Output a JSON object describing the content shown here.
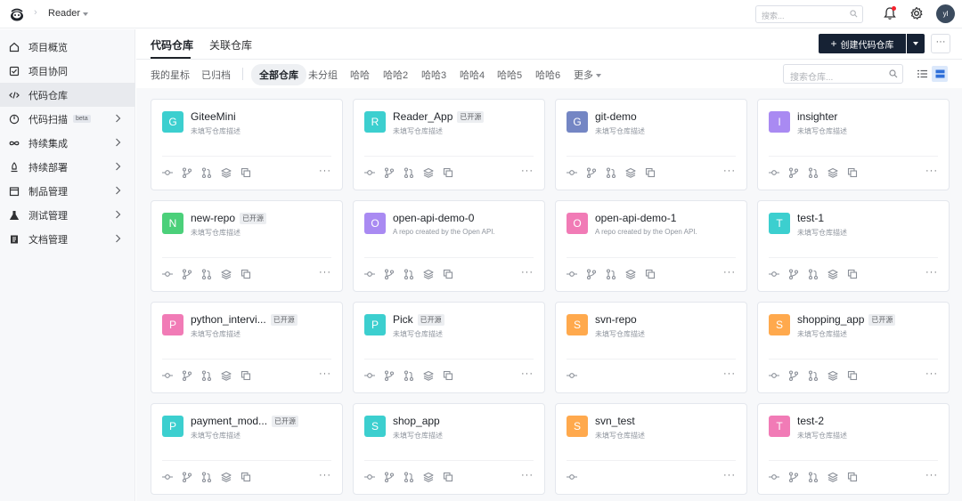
{
  "header": {
    "project_name": "Reader",
    "search_placeholder": "搜索...",
    "avatar_text": "yl"
  },
  "sidebar": {
    "items": [
      {
        "label": "项目概览",
        "icon": "home-icon",
        "chevron": false,
        "active": false
      },
      {
        "label": "项目协同",
        "icon": "checkbox-icon",
        "chevron": false,
        "active": false
      },
      {
        "label": "代码仓库",
        "icon": "code-icon",
        "chevron": false,
        "active": true
      },
      {
        "label": "代码扫描",
        "icon": "scan-icon",
        "chevron": true,
        "active": false,
        "beta": "beta"
      },
      {
        "label": "持续集成",
        "icon": "infinity-icon",
        "chevron": true,
        "active": false
      },
      {
        "label": "持续部署",
        "icon": "rocket-icon",
        "chevron": true,
        "active": false
      },
      {
        "label": "制品管理",
        "icon": "package-icon",
        "chevron": true,
        "active": false
      },
      {
        "label": "测试管理",
        "icon": "flask-icon",
        "chevron": true,
        "active": false
      },
      {
        "label": "文档管理",
        "icon": "document-icon",
        "chevron": true,
        "active": false
      }
    ]
  },
  "main": {
    "tabs": [
      {
        "label": "代码仓库",
        "active": true
      },
      {
        "label": "关联仓库",
        "active": false
      }
    ],
    "create_button": "创建代码仓库",
    "more_button": "···",
    "filters": [
      {
        "label": "我的星标",
        "active": false
      },
      {
        "label": "已归档",
        "active": false
      },
      {
        "label": "全部仓库",
        "active": true
      },
      {
        "label": "未分组",
        "active": false
      },
      {
        "label": "哈哈",
        "active": false
      },
      {
        "label": "哈哈2",
        "active": false
      },
      {
        "label": "哈哈3",
        "active": false
      },
      {
        "label": "哈哈4",
        "active": false
      },
      {
        "label": "哈哈5",
        "active": false
      },
      {
        "label": "哈哈6",
        "active": false
      },
      {
        "label": "更多",
        "active": false
      }
    ],
    "repo_search_placeholder": "搜索仓库...",
    "open_tag": "已开源",
    "more_dots": "···"
  },
  "colors": {
    "teal": "#3ccfcf",
    "indigo": "#7486c4",
    "purple": "#a58cf0",
    "green": "#4bd07a",
    "violet": "#a98af2",
    "pink": "#f17bb6",
    "orange": "#ffa94d",
    "primary_button": "#162234"
  },
  "repos": [
    {
      "letter": "G",
      "name": "GiteeMini",
      "desc": "未填写仓库描述",
      "open": false,
      "color": "#3ccfcf",
      "actions": 5
    },
    {
      "letter": "R",
      "name": "Reader_App",
      "desc": "未填写仓库描述",
      "open": true,
      "color": "#3ccfcf",
      "actions": 5
    },
    {
      "letter": "G",
      "name": "git-demo",
      "desc": "未填写仓库描述",
      "open": false,
      "color": "#7486c4",
      "actions": 5
    },
    {
      "letter": "I",
      "name": "insighter",
      "desc": "未填写仓库描述",
      "open": false,
      "color": "#a98af2",
      "actions": 5
    },
    {
      "letter": "N",
      "name": "new-repo",
      "desc": "未填写仓库描述",
      "open": true,
      "color": "#4bd07a",
      "actions": 5
    },
    {
      "letter": "O",
      "name": "open-api-demo-0",
      "desc": "A repo created by the Open API.",
      "open": false,
      "color": "#a98af2",
      "actions": 5
    },
    {
      "letter": "O",
      "name": "open-api-demo-1",
      "desc": "A repo created by the Open API.",
      "open": false,
      "color": "#f17bb6",
      "actions": 5
    },
    {
      "letter": "T",
      "name": "test-1",
      "desc": "未填写仓库描述",
      "open": false,
      "color": "#3ccfcf",
      "actions": 5
    },
    {
      "letter": "P",
      "name": "python_intervi...",
      "desc": "未填写仓库描述",
      "open": true,
      "color": "#f17bb6",
      "actions": 5
    },
    {
      "letter": "P",
      "name": "Pick",
      "desc": "未填写仓库描述",
      "open": true,
      "color": "#3ccfcf",
      "actions": 5
    },
    {
      "letter": "S",
      "name": "svn-repo",
      "desc": "未填写仓库描述",
      "open": false,
      "color": "#ffa94d",
      "actions": 1
    },
    {
      "letter": "S",
      "name": "shopping_app",
      "desc": "未填写仓库描述",
      "open": true,
      "color": "#ffa94d",
      "actions": 5
    },
    {
      "letter": "P",
      "name": "payment_mod...",
      "desc": "未填写仓库描述",
      "open": true,
      "color": "#3ccfcf",
      "actions": 5
    },
    {
      "letter": "S",
      "name": "shop_app",
      "desc": "未填写仓库描述",
      "open": false,
      "color": "#3ccfcf",
      "actions": 5
    },
    {
      "letter": "S",
      "name": "svn_test",
      "desc": "未填写仓库描述",
      "open": false,
      "color": "#ffa94d",
      "actions": 1
    },
    {
      "letter": "T",
      "name": "test-2",
      "desc": "未填写仓库描述",
      "open": false,
      "color": "#f17bb6",
      "actions": 5
    }
  ]
}
